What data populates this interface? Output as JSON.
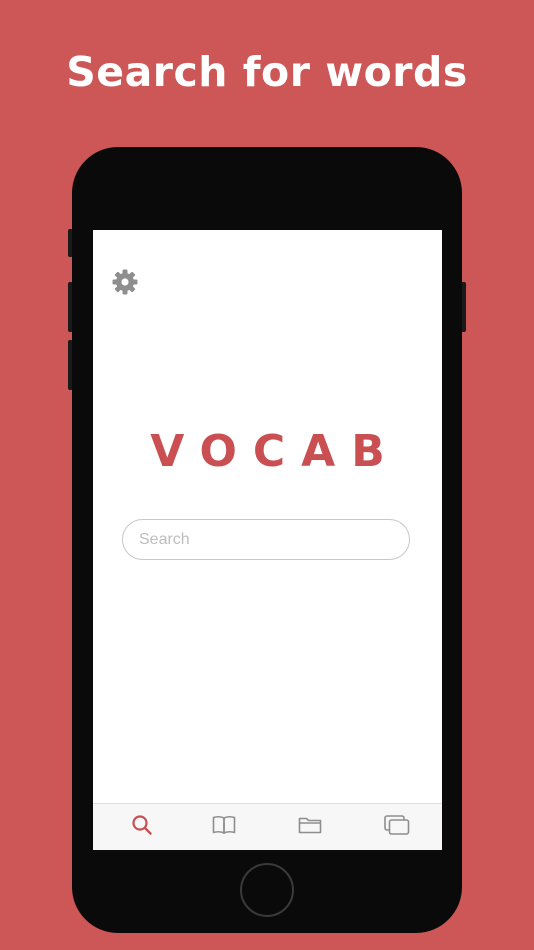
{
  "headline": "Search for words",
  "app": {
    "logo_text": "VOCAB"
  },
  "search": {
    "placeholder": "Search",
    "value": ""
  },
  "tabs": [
    {
      "icon": "search-icon",
      "active": true
    },
    {
      "icon": "book-icon",
      "active": false
    },
    {
      "icon": "folder-icon",
      "active": false
    },
    {
      "icon": "cards-icon",
      "active": false
    }
  ],
  "colors": {
    "background": "#cd5656",
    "accent": "#c94f52",
    "icon_inactive": "#8e8e8e",
    "phone_body": "#0a0a0a"
  }
}
